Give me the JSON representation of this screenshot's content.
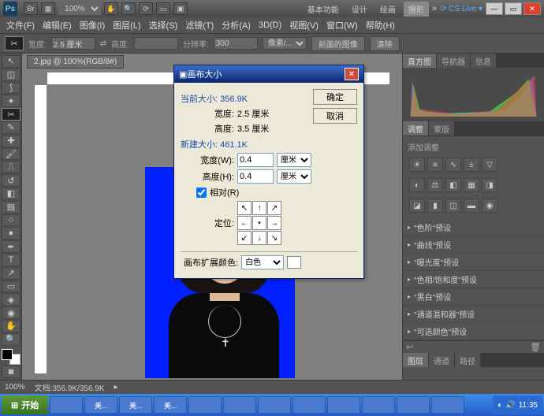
{
  "app": {
    "logo": "Ps"
  },
  "title_tabs": [
    "基本功能",
    "设计",
    "绘画",
    "摄影"
  ],
  "title_tabs_active": 3,
  "cs_live": "CS Live",
  "zoom_dropdown": "100%",
  "menu": [
    "文件(F)",
    "编辑(E)",
    "图像(I)",
    "图层(L)",
    "选择(S)",
    "滤镜(T)",
    "分析(A)",
    "3D(D)",
    "视图(V)",
    "窗口(W)",
    "帮助(H)"
  ],
  "optionsbar": {
    "width_label": "宽度:",
    "width_val": "2.5 厘米",
    "height_label": "高度:",
    "height_val": "",
    "res_label": "分辨率:",
    "res_val": "300",
    "res_unit": "像素/...",
    "front_btn": "前面的图像",
    "clear_btn": "清除"
  },
  "doc_tab": "2.jpg @ 100%(RGB/8#)",
  "status": {
    "zoom": "100%",
    "filesize": "文档:356.9K/356.9K"
  },
  "dialog": {
    "title": "画布大小",
    "ok": "确定",
    "cancel": "取消",
    "current_label": "当前大小: 356.9K",
    "cur_w_label": "宽度:",
    "cur_w": "2.5 厘米",
    "cur_h_label": "高度:",
    "cur_h": "3.5 厘米",
    "new_label": "新建大小: 461.1K",
    "new_w_label": "宽度(W):",
    "new_w": "0.4",
    "unit_w": "厘米",
    "new_h_label": "高度(H):",
    "new_h": "0.4",
    "unit_h": "厘米",
    "relative": "相对(R)",
    "anchor_label": "定位:",
    "ext_label": "画布扩展颜色:",
    "ext_val": "白色"
  },
  "panels": {
    "histo_tabs": [
      "直方图",
      "导航器",
      "信息"
    ],
    "adjust_tabs": [
      "调整",
      "蒙版"
    ],
    "adjust_hint": "添加调整",
    "presets": [
      "\"色阶\"预设",
      "\"曲线\"预设",
      "\"曝光度\"预设",
      "\"色相/饱和度\"预设",
      "\"黑白\"预设",
      "\"通道混和器\"预设",
      "\"可选颜色\"预设"
    ],
    "layer_tabs": [
      "图层",
      "通道",
      "路径"
    ]
  },
  "taskbar": {
    "start": "开始",
    "tasks": [
      "",
      "美...",
      "美...",
      "美...",
      "",
      "",
      "",
      "",
      "",
      "",
      "",
      ""
    ],
    "time": "11:35"
  }
}
